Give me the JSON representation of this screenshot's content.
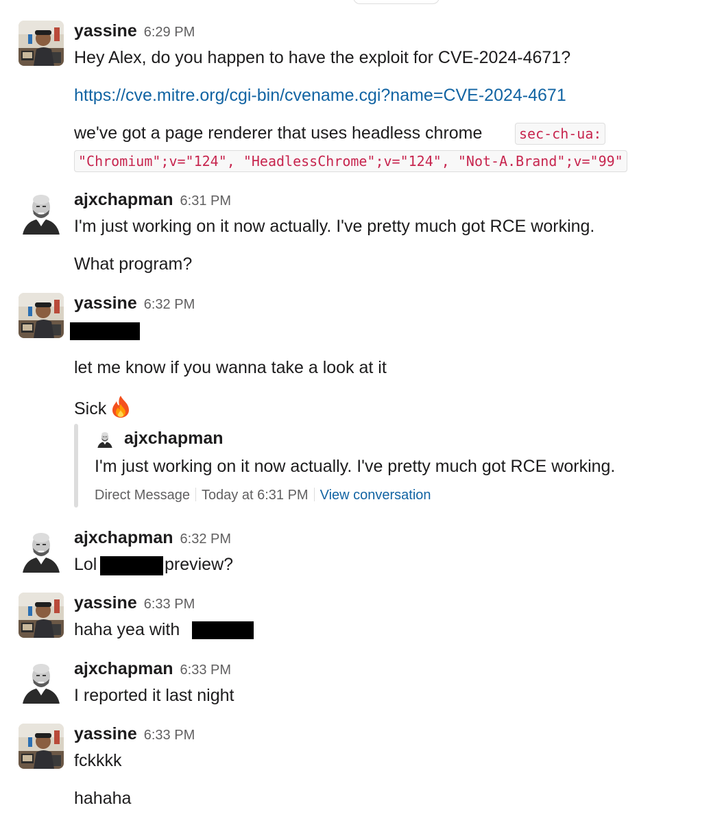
{
  "messages": [
    {
      "author": "yassine",
      "time": "6:29 PM",
      "text1": "Hey Alex, do you happen to have the exploit for CVE-2024-4671?",
      "link": "https://cve.mitre.org/cgi-bin/cvename.cgi?name=CVE-2024-4671",
      "text3": "we've got a page renderer that uses headless chrome",
      "code1": "sec-ch-ua:",
      "code2": "\"Chromium\";v=\"124\", \"HeadlessChrome\";v=\"124\", \"Not-A.Brand\";v=\"99\""
    },
    {
      "author": "ajxchapman",
      "time": "6:31 PM",
      "text1": "I'm just working on it now actually. I've pretty much got RCE working.",
      "text2": "What program?"
    },
    {
      "author": "yassine",
      "time": "6:32 PM",
      "text2": "let me know if you wanna take a look at it",
      "text3": "Sick",
      "emoji": "fire-icon",
      "quote": {
        "author": "ajxchapman",
        "text": "I'm just working on it now actually. I've pretty much got RCE working.",
        "source": "Direct Message",
        "when": "Today at 6:31 PM",
        "view_link": "View conversation"
      }
    },
    {
      "author": "ajxchapman",
      "time": "6:32 PM",
      "text_before": "Lol",
      "text_after": "preview?"
    },
    {
      "author": "yassine",
      "time": "6:33 PM",
      "text1": "haha yea with"
    },
    {
      "author": "ajxchapman",
      "time": "6:33 PM",
      "text1": "I reported it last night"
    },
    {
      "author": "yassine",
      "time": "6:33 PM",
      "text1": "fckkkk",
      "text2": "hahaha"
    }
  ],
  "colors": {
    "link": "#1264a3",
    "code": "#c7254e",
    "meta": "#616061",
    "text": "#1d1c1d"
  }
}
